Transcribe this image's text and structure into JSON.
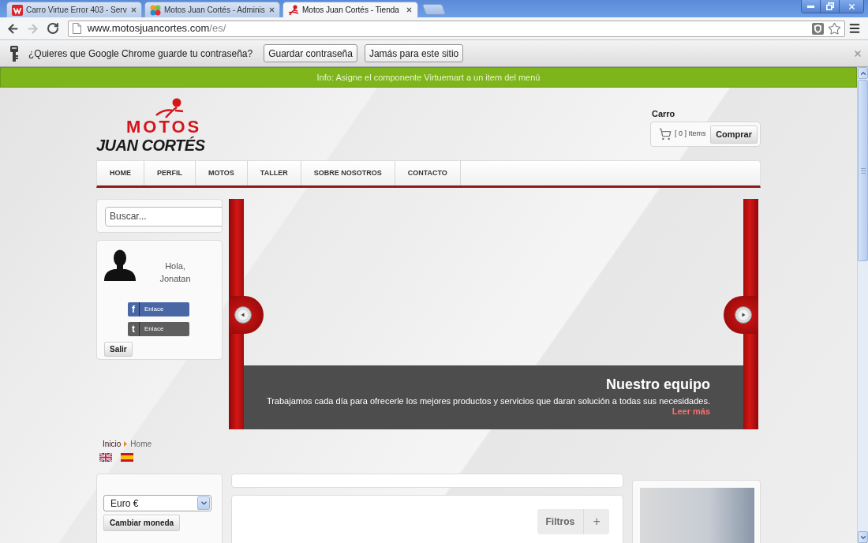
{
  "browser": {
    "tabs": [
      {
        "title": "Carro Virtue Error 403 - Serv",
        "selected": false
      },
      {
        "title": "Motos Juan Cortés - Adminis",
        "selected": false
      },
      {
        "title": "Motos Juan Cortés - Tienda",
        "selected": true
      }
    ],
    "history": {
      "can_go_back": true,
      "can_go_forward": false
    },
    "address": {
      "host": "www.motosjuancortes.com",
      "path": "/es/"
    },
    "bookmarked": false,
    "password_bar": {
      "message": "¿Quieres que Google Chrome guarde tu contraseña?",
      "buttons": [
        "Guardar contraseña",
        "Jamás para este sitio"
      ]
    }
  },
  "info_bar": {
    "text": "Info: Asigne el componente Virtuemart a un item del menú"
  },
  "header": {
    "logo": {
      "top": "MOTOS",
      "bottom": "JUAN CORTÉS"
    },
    "cart": {
      "title": "Carro",
      "count": "[ 0 ] Items",
      "button": "Comprar"
    }
  },
  "nav": [
    "HOME",
    "PERFIL",
    "MOTOS",
    "TALLER",
    "SOBRE NOSOTROS",
    "CONTACTO"
  ],
  "search": {
    "placeholder": "Buscar..."
  },
  "login": {
    "greeting": "Hola, Jonatan",
    "links": [
      {
        "icon": "f",
        "label": "Enlace",
        "color": "#4a67a5"
      },
      {
        "icon": "t",
        "label": "Enlace",
        "color": "#5e5e5e"
      }
    ],
    "logout": "Salir"
  },
  "slider": {
    "title": "Nuestro equipo",
    "text": "Trabajamos cada día para ofrecerle los mejores productos y servicios que daran solución a todas sus necesidades.",
    "link": "Leer más"
  },
  "breadcrumb": [
    "Inicio",
    "Home"
  ],
  "currency": {
    "value": "Euro €",
    "button": "Cambiar moneda"
  },
  "filters": {
    "label": "Filtros",
    "toggle": "+"
  }
}
